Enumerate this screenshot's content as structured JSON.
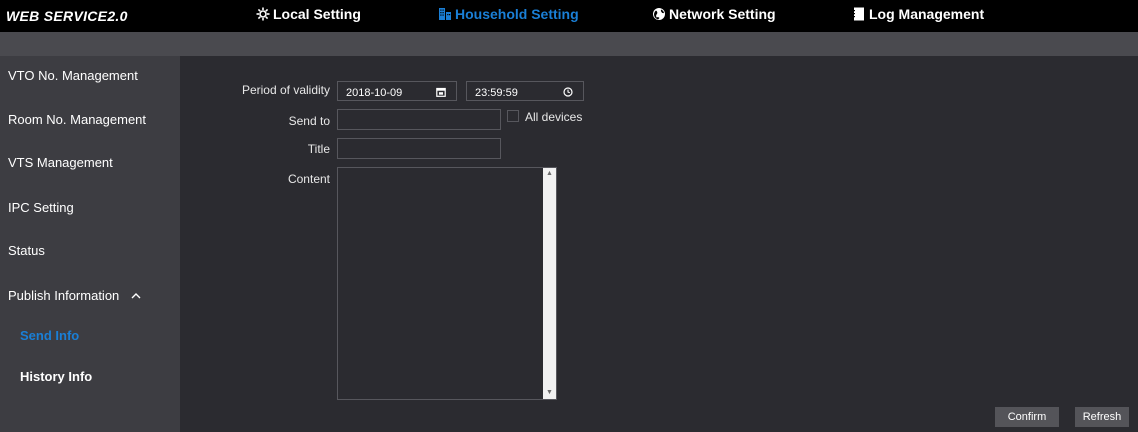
{
  "header": {
    "brand": "WEB SERVICE2.0",
    "tabs": [
      {
        "label": "Local Setting",
        "icon": "gear-icon"
      },
      {
        "label": "Household Setting",
        "icon": "building-icon",
        "active": true
      },
      {
        "label": "Network Setting",
        "icon": "globe-icon"
      },
      {
        "label": "Log Management",
        "icon": "document-icon"
      }
    ]
  },
  "sidebar": {
    "items": [
      {
        "label": "VTO No. Management"
      },
      {
        "label": "Room No. Management"
      },
      {
        "label": "VTS Management"
      },
      {
        "label": "IPC Setting"
      },
      {
        "label": "Status"
      },
      {
        "label": "Publish Information"
      },
      {
        "label": "Send Info"
      },
      {
        "label": "History Info"
      }
    ]
  },
  "form": {
    "period_label": "Period of validity",
    "date_value": "2018-10-09",
    "time_value": "23:59:59",
    "send_to_label": "Send to",
    "send_to_value": "",
    "all_devices_label": "All devices",
    "title_label": "Title",
    "title_value": "",
    "content_label": "Content",
    "content_value": ""
  },
  "buttons": {
    "confirm": "Confirm",
    "refresh": "Refresh"
  },
  "colors": {
    "accent": "#1a7fd6",
    "topbar": "#000000",
    "sidebar": "#3d3d42",
    "main": "#2b2b30"
  }
}
